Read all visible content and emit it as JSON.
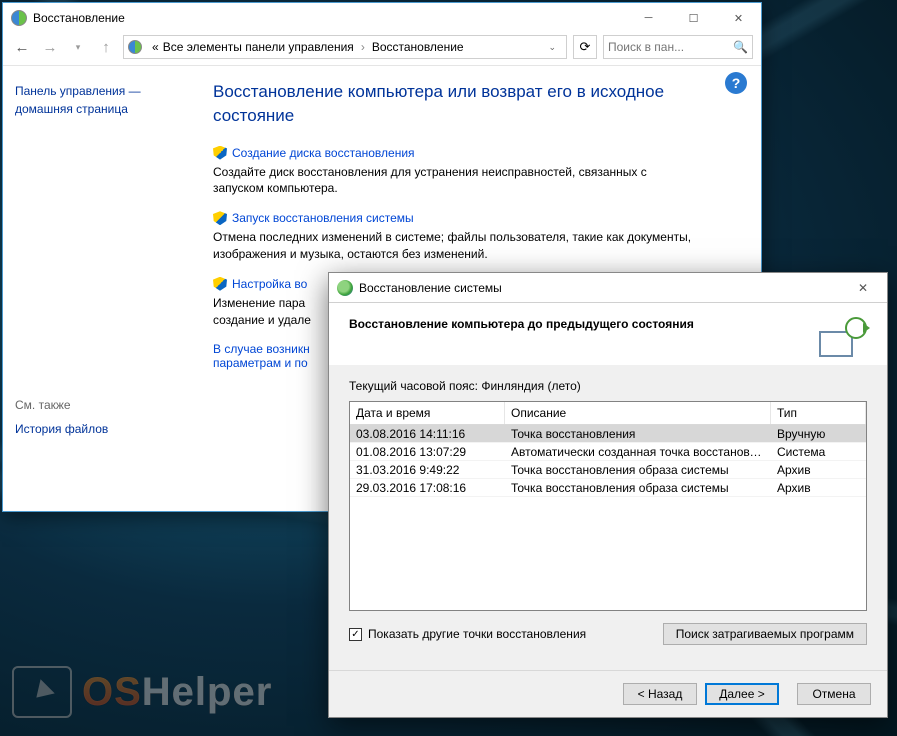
{
  "cp": {
    "title": "Восстановление",
    "breadcrumb": {
      "prefix": "«",
      "parent": "Все элементы панели управления",
      "current": "Восстановление"
    },
    "search_placeholder": "Поиск в пан...",
    "sidebar": {
      "home": "Панель управления — домашняя страница",
      "see_also": "См. также",
      "history_link": "История файлов"
    },
    "page_title": "Восстановление компьютера или возврат его в исходное состояние",
    "sections": [
      {
        "link": "Создание диска восстановления",
        "desc": "Создайте диск восстановления для устранения неисправностей, связанных с запуском компьютера."
      },
      {
        "link": "Запуск восстановления системы",
        "desc": "Отмена последних изменений в системе; файлы пользователя, такие как документы, изображения и музыка, остаются без изменений."
      },
      {
        "link": "Настройка во",
        "desc": "Изменение пара\nсоздание и удале"
      },
      {
        "link": "В случае возникн\nпараметрам и по",
        "desc": ""
      }
    ]
  },
  "wizard": {
    "title": "Восстановление системы",
    "heading": "Восстановление компьютера до предыдущего состояния",
    "timezone": "Текущий часовой пояс: Финляндия (лето)",
    "columns": {
      "dt": "Дата и время",
      "desc": "Описание",
      "type": "Тип"
    },
    "rows": [
      {
        "dt": "03.08.2016 14:11:16",
        "desc": "Точка восстановления",
        "type": "Вручную"
      },
      {
        "dt": "01.08.2016 13:07:29",
        "desc": "Автоматически созданная точка восстановле...",
        "type": "Система"
      },
      {
        "dt": "31.03.2016 9:49:22",
        "desc": "Точка восстановления образа системы",
        "type": "Архив"
      },
      {
        "dt": "29.03.2016 17:08:16",
        "desc": "Точка восстановления образа системы",
        "type": "Архив"
      }
    ],
    "checkbox": "Показать другие точки восстановления",
    "affected_btn": "Поиск затрагиваемых программ",
    "buttons": {
      "back": "< Назад",
      "next": "Далее >",
      "cancel": "Отмена"
    }
  },
  "watermark": {
    "brand": "OS",
    "rest": "Helper"
  }
}
